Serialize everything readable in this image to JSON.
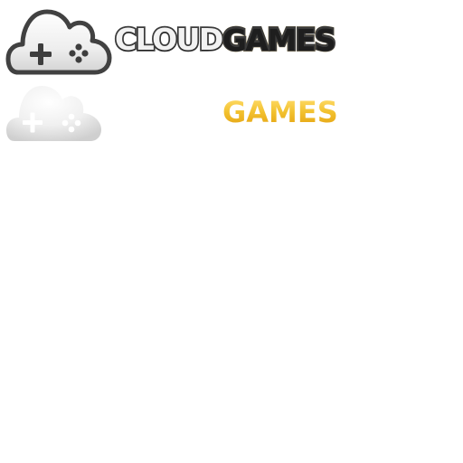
{
  "logo_primary": {
    "wordmark_part1": "CLOUD",
    "wordmark_part2": "GAMES",
    "icon": "cloud-gamepad-icon",
    "colors": {
      "cloud_fill": "#efefef",
      "outline": "#3b3b3b",
      "games_gold": "#f2c12e"
    }
  },
  "logo_variant": {
    "wordmark": "GAMES",
    "icon": "cloud-gamepad-icon",
    "colors": {
      "cloud_fill": "#e9e9e9",
      "games_gold": "#f0b928"
    }
  }
}
